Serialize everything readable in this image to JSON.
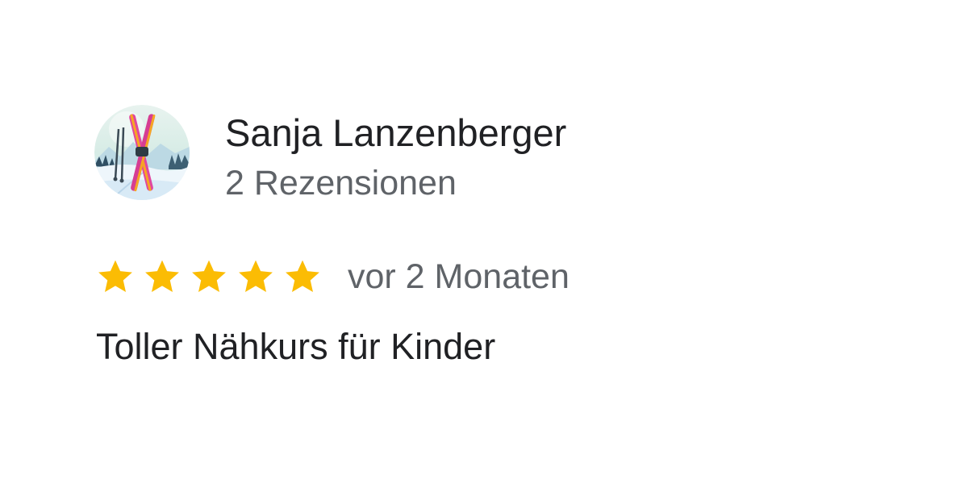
{
  "reviewer": {
    "name": "Sanja Lanzenberger",
    "review_count": "2 Rezensionen",
    "avatar_icon": "ski-avatar-icon"
  },
  "review": {
    "rating": 5,
    "max_rating": 5,
    "time_ago": "vor 2 Monaten",
    "text": "Toller Nähkurs für Kinder"
  },
  "colors": {
    "star": "#FBBC04",
    "name": "#202124",
    "secondary": "#5F6368"
  }
}
